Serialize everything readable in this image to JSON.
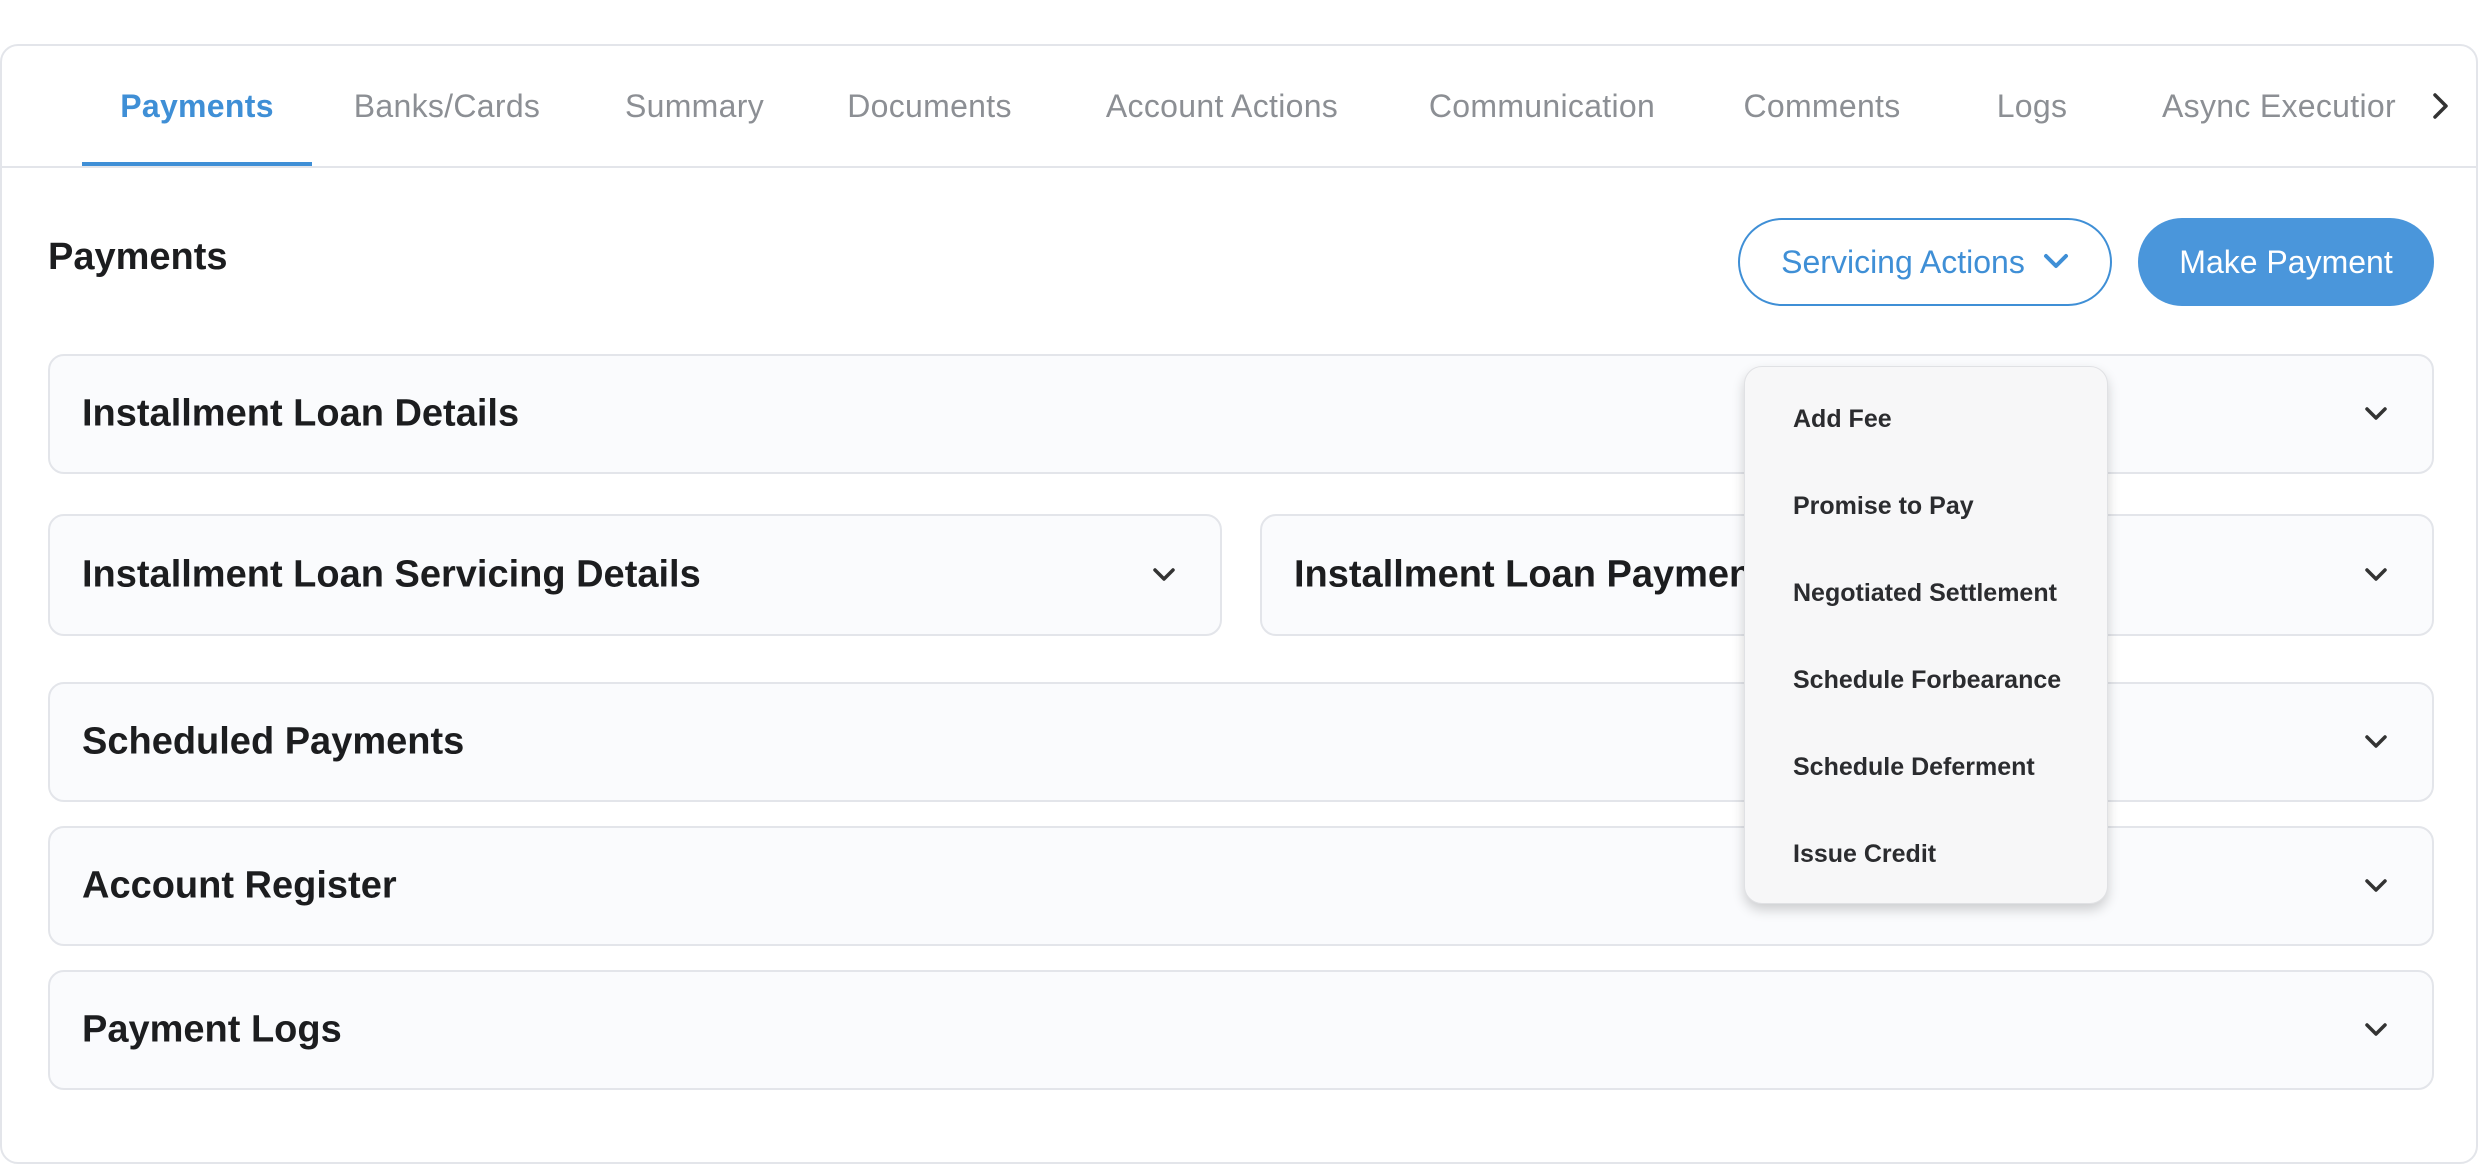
{
  "tabs": [
    {
      "label": "Payments",
      "active": true
    },
    {
      "label": "Banks/Cards",
      "active": false
    },
    {
      "label": "Summary",
      "active": false
    },
    {
      "label": "Documents",
      "active": false
    },
    {
      "label": "Account Actions",
      "active": false
    },
    {
      "label": "Communication",
      "active": false
    },
    {
      "label": "Comments",
      "active": false
    },
    {
      "label": "Logs",
      "active": false
    },
    {
      "label": "Async Executior",
      "active": false
    }
  ],
  "header": {
    "title": "Payments",
    "servicing_actions_label": "Servicing Actions",
    "make_payment_label": "Make Payment"
  },
  "panels": {
    "installment_loan_details": "Installment Loan Details",
    "servicing_details": "Installment Loan Servicing Details",
    "payment_details": "Installment Loan Paymen",
    "scheduled_payments": "Scheduled Payments",
    "account_register": "Account Register",
    "payment_logs": "Payment Logs"
  },
  "servicing_menu": {
    "items": [
      "Add Fee",
      "Promise to Pay",
      "Negotiated Settlement",
      "Schedule Forbearance",
      "Schedule Deferment",
      "Issue Credit"
    ]
  },
  "colors": {
    "accent": "#3f8fd6",
    "primary_button": "#4a96db",
    "inactive_tab_text": "#8c8f94",
    "panel_background": "#fafbfd",
    "border": "#e3e5ea"
  },
  "icons": {
    "tab_scroll": "chevron-right-icon",
    "dropdown": "chevron-down-icon",
    "panel_toggle": "chevron-down-icon"
  }
}
